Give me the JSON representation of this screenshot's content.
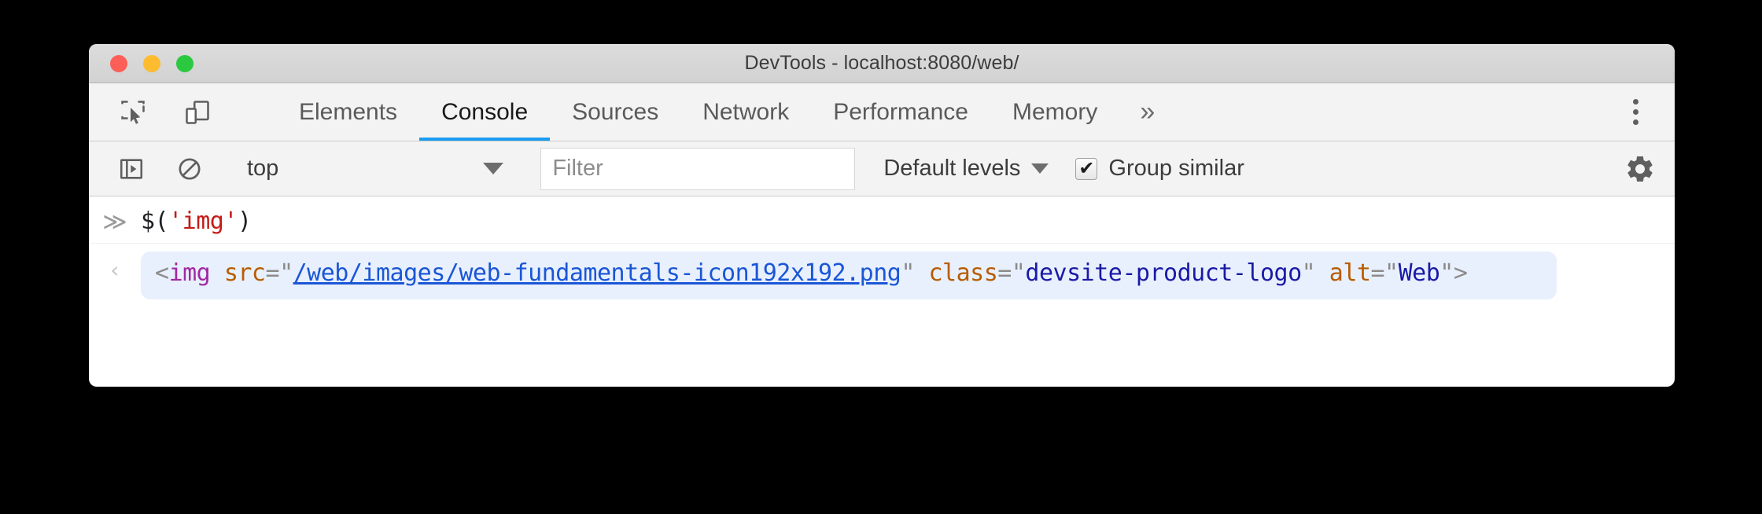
{
  "window": {
    "title": "DevTools - localhost:8080/web/",
    "traffic_lights": [
      {
        "name": "close",
        "color": "#fc5f57"
      },
      {
        "name": "minimize",
        "color": "#fdbc2f"
      },
      {
        "name": "zoom",
        "color": "#2bc940"
      }
    ]
  },
  "toolbar": {
    "inspect_icon": "inspect-element-icon",
    "device_icon": "device-toolbar-icon",
    "overflow_label": "»",
    "menu_icon": "more-options-icon"
  },
  "tabs": [
    {
      "label": "Elements",
      "active": false
    },
    {
      "label": "Console",
      "active": true
    },
    {
      "label": "Sources",
      "active": false
    },
    {
      "label": "Network",
      "active": false
    },
    {
      "label": "Performance",
      "active": false
    },
    {
      "label": "Memory",
      "active": false
    }
  ],
  "console_toolbar": {
    "sidebar_icon": "console-sidebar-icon",
    "clear_icon": "clear-console-icon",
    "context": "top",
    "filter_placeholder": "Filter",
    "filter_value": "",
    "levels_label": "Default levels",
    "group_similar_label": "Group similar",
    "group_similar_checked": true,
    "checkmark": "✔",
    "settings_icon": "settings-gear-icon"
  },
  "console": {
    "prompt_symbol": "≫",
    "result_symbol": "‹",
    "command": {
      "before": "$(",
      "string": "'img'",
      "after": ")"
    },
    "result": {
      "open_angle": "<",
      "tag": "img",
      "space1": " ",
      "attr_src": "src",
      "eq1": "=",
      "quote1": "\"",
      "src_url": "/web/images/web-fundamentals-icon192x192.png",
      "quote2": "\"",
      "space2": " ",
      "attr_class": "class",
      "eq2": "=",
      "quote3": "\"",
      "class_value": "devsite-product-logo",
      "quote4": "\"",
      "space3": " ",
      "attr_alt": "alt",
      "eq3": "=",
      "quote5": "\"",
      "alt_value": "Web",
      "quote6": "\"",
      "close_angle": ">"
    }
  },
  "colors": {
    "accent": "#1a9bf0",
    "result_bg": "#e8f0fe",
    "string": "#c41a16",
    "tag": "#a228a2",
    "attribute": "#b85c00",
    "attr_value": "#1a1aa6",
    "link": "#1a56d6"
  }
}
